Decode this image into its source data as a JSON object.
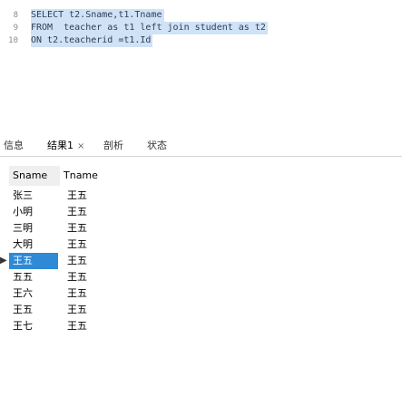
{
  "editor": {
    "lines": [
      {
        "num": "8",
        "code": "SELECT t2.Sname,t1.Tname"
      },
      {
        "num": "9",
        "code": "FROM  teacher as t1 left join student as t2"
      },
      {
        "num": "10",
        "code": "ON t2.teacherid =t1.Id"
      }
    ]
  },
  "tabs": [
    {
      "label": "信息",
      "close": ""
    },
    {
      "label": "结果1",
      "close": "×"
    },
    {
      "label": "剖析",
      "close": ""
    },
    {
      "label": "状态",
      "close": ""
    }
  ],
  "grid": {
    "columns": [
      "Sname",
      "Tname"
    ],
    "selected_marker": "▶",
    "rows": [
      {
        "sname": "张三",
        "tname": "王五"
      },
      {
        "name_unused": "",
        "sname": "小明",
        "tname": "王五"
      },
      {
        "sname": "三明",
        "tname": "王五"
      },
      {
        "sname": "大明",
        "tname": "王五"
      },
      {
        "sname": "王五",
        "tname": "王五"
      },
      {
        "sname": "五五",
        "tname": "王五"
      },
      {
        "sname": "王六",
        "tname": "王五"
      },
      {
        "sname": "王五",
        "tname": "王五"
      },
      {
        "sname": "王七",
        "tname": "王五"
      }
    ]
  }
}
